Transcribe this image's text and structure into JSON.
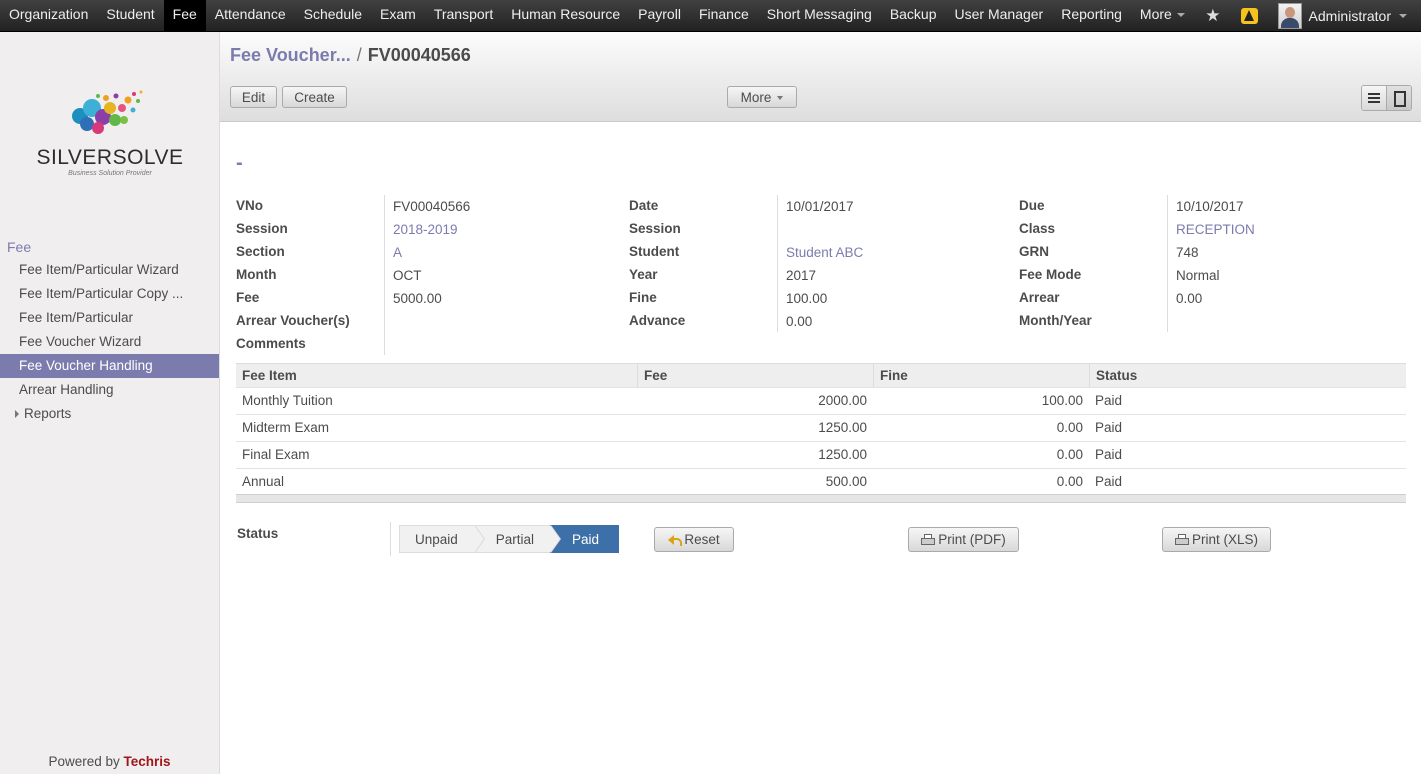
{
  "topnav": {
    "items": [
      "Organization",
      "Student",
      "Fee",
      "Attendance",
      "Schedule",
      "Exam",
      "Transport",
      "Human Resource",
      "Payroll",
      "Finance",
      "Short Messaging",
      "Backup",
      "User Manager",
      "Reporting",
      "More"
    ],
    "active_index": 2,
    "user_name": "Administrator",
    "icons": [
      "star-icon",
      "alert-icon",
      "avatar"
    ]
  },
  "sidebar": {
    "logo_text": "SILVERSOLVE",
    "logo_subtitle": "Business Solution Provider",
    "section": "Fee",
    "items": [
      {
        "label": "Fee Item/Particular Wizard"
      },
      {
        "label": "Fee Item/Particular Copy ..."
      },
      {
        "label": "Fee Item/Particular"
      },
      {
        "label": "Fee Voucher Wizard"
      },
      {
        "label": "Fee Voucher Handling"
      },
      {
        "label": "Arrear Handling"
      },
      {
        "label": "Reports"
      }
    ],
    "active_index": 4,
    "powered_prefix": "Powered by",
    "powered_brand": "Techris"
  },
  "breadcrumb": {
    "parent": "Fee Voucher...",
    "separator": "/",
    "current": "FV00040566"
  },
  "toolbar": {
    "edit_label": "Edit",
    "create_label": "Create",
    "more_label": "More"
  },
  "form": {
    "title": "-",
    "fields": {
      "vno_label": "VNo",
      "vno": "FV00040566",
      "date_label": "Date",
      "date": "10/01/2017",
      "due_label": "Due",
      "due": "10/10/2017",
      "session_label": "Session",
      "session": "2018-2019",
      "session2_label": "Session",
      "session2": "",
      "class_label": "Class",
      "class": "RECEPTION",
      "section_label": "Section",
      "section": "A",
      "student_label": "Student",
      "student": "Student ABC",
      "grn_label": "GRN",
      "grn": "748",
      "month_label": "Month",
      "month": "OCT",
      "year_label": "Year",
      "year": "2017",
      "fee_mode_label": "Fee Mode",
      "fee_mode": "Normal",
      "fee_label": "Fee",
      "fee": "5000.00",
      "fine_label": "Fine",
      "fine": "100.00",
      "arrear_label": "Arrear",
      "arrear": "0.00",
      "arrear_vouchers_label": "Arrear Voucher(s)",
      "arrear_vouchers": "",
      "advance_label": "Advance",
      "advance": "0.00",
      "month_year_label": "Month/Year",
      "month_year": "",
      "comments_label": "Comments",
      "comments": ""
    },
    "table": {
      "headers": [
        "Fee Item",
        "Fee",
        "Fine",
        "Status"
      ],
      "rows": [
        {
          "item": "Monthly Tuition",
          "fee": "2000.00",
          "fine": "100.00",
          "status": "Paid"
        },
        {
          "item": "Midterm Exam",
          "fee": "1250.00",
          "fine": "0.00",
          "status": "Paid"
        },
        {
          "item": "Final Exam",
          "fee": "1250.00",
          "fine": "0.00",
          "status": "Paid"
        },
        {
          "item": "Annual",
          "fee": "500.00",
          "fine": "0.00",
          "status": "Paid"
        }
      ]
    },
    "status": {
      "label": "Status",
      "stages": [
        "Unpaid",
        "Partial",
        "Paid"
      ],
      "active_stage": "Paid",
      "reset_label": "Reset",
      "print_pdf_label": "Print (PDF)",
      "print_xls_label": "Print (XLS)"
    }
  },
  "colors": {
    "accent": "#7c7bad",
    "status_active": "#3d6fa8",
    "brand_red": "#a0161c",
    "navbar": "#2b2b2b"
  }
}
